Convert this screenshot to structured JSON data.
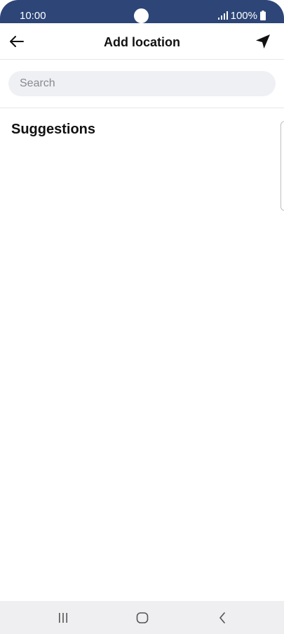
{
  "status_bar": {
    "time": "10:00",
    "battery": "100%",
    "icons": [
      "signal-icon",
      "battery-icon"
    ]
  },
  "header": {
    "title": "Add location",
    "back_icon": "arrow-left-icon",
    "location_icon": "navigation-arrow-icon"
  },
  "search": {
    "placeholder": "Search",
    "value": ""
  },
  "suggestions": {
    "title": "Suggestions",
    "items": []
  },
  "nav_bar": {
    "icons": [
      "recents-icon",
      "home-icon",
      "back-icon"
    ]
  },
  "colors": {
    "status_bar": "#2d4577",
    "search_bg": "#eff0f4",
    "nav_bar_bg": "#efeff1"
  }
}
